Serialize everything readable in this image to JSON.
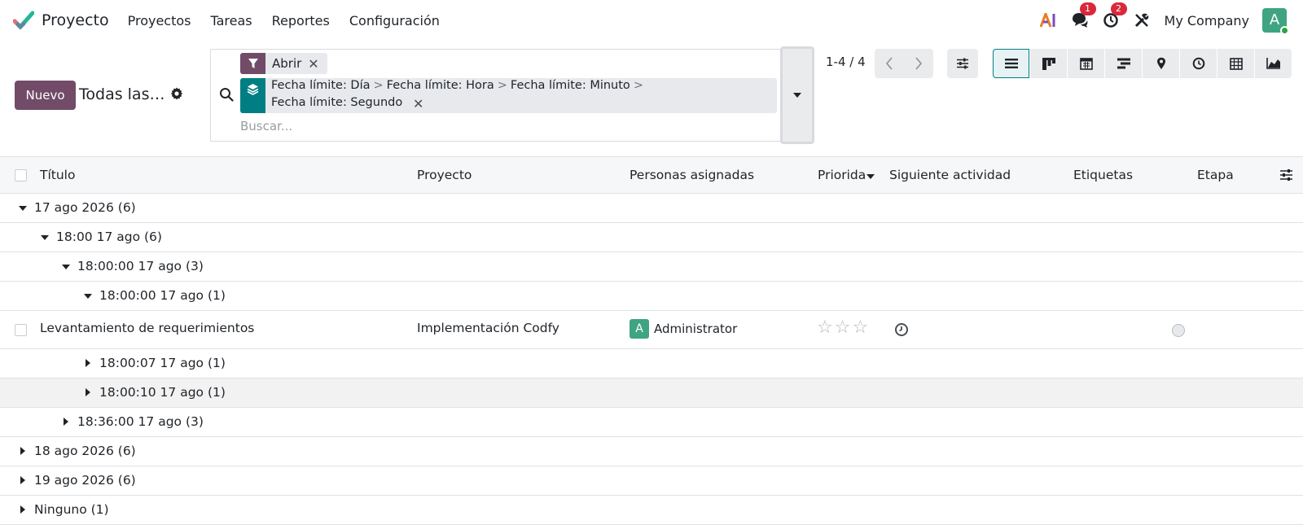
{
  "navbar": {
    "app_name": "Proyecto",
    "menu": [
      "Proyectos",
      "Tareas",
      "Reportes",
      "Configuración"
    ],
    "messages_badge": "1",
    "activities_badge": "2",
    "company": "My Company",
    "user_initial": "A"
  },
  "control": {
    "new_label": "Nuevo",
    "view_title": "Todas las…",
    "facet_filter": "Abrir",
    "groupby_line1": [
      "Fecha límite: Día",
      "Fecha límite: Hora",
      "Fecha límite: Minuto"
    ],
    "groupby_line2": "Fecha límite: Segundo",
    "search_placeholder": "Buscar...",
    "pager": "1-4 / 4"
  },
  "views": [
    "list-icon",
    "kanban-icon",
    "calendar-icon",
    "gantt-icon",
    "map-icon",
    "activity-icon",
    "pivot-icon",
    "graph-icon"
  ],
  "columns": {
    "title": "Título",
    "project": "Proyecto",
    "assignees": "Personas asignadas",
    "priority": "Priorida",
    "next_activity": "Siguiente actividad",
    "tags": "Etiquetas",
    "stage": "Etapa"
  },
  "groups": {
    "g1": "17 ago 2026 (6)",
    "g1_1": "18:00 17 ago (6)",
    "g1_1_1": "18:00:00 17 ago (3)",
    "g1_1_1_1": "18:00:00 17 ago (1)",
    "g1_1_1_2": "18:00:07 17 ago (1)",
    "g1_1_1_3": "18:00:10 17 ago (1)",
    "g1_1_2": "18:36:00 17 ago (3)",
    "g2": "18 ago 2026 (6)",
    "g3": "19 ago 2026 (6)",
    "g4": "Ninguno (1)"
  },
  "record": {
    "title": "Levantamiento de requerimientos",
    "project": "Implementación Codfy",
    "assignee_initial": "A",
    "assignee": "Administrator"
  },
  "colors": {
    "primary": "#714b67",
    "teal": "#017e84",
    "badge": "#d9283b",
    "avatar": "#3fa481"
  }
}
